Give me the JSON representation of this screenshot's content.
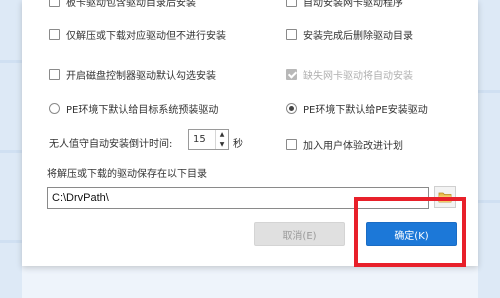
{
  "options": {
    "top_left": "板卡驱动包含驱动目录后安装",
    "top_right": "自动安装网卡驱动程序",
    "extract_only": "仅解压或下载对应驱动但不进行安装",
    "delete_after_install": "安装完成后删除驱动目录",
    "enable_disk_controller": "开启磁盘控制器驱动默认勾选安装",
    "missing_nic_auto": "缺失网卡驱动将自动安装",
    "pe_target_system": "PE环境下默认给目标系统预装驱动",
    "pe_install_pe": "PE环境下默认给PE安装驱动"
  },
  "countdown": {
    "label": "无人值守自动安装倒计时间:",
    "value": "15",
    "unit": "秒",
    "up_arrow": "▲",
    "down_arrow": "▼"
  },
  "join_program": "加入用户体验改进计划",
  "save_dir": {
    "label": "将解压或下载的驱动保存在以下目录",
    "path": "C:\\DrvPath\\"
  },
  "buttons": {
    "cancel": "取消(E)",
    "ok": "确定(K)"
  },
  "colors": {
    "ok_button": "#1c78d8",
    "highlight_box": "#e8202a"
  }
}
